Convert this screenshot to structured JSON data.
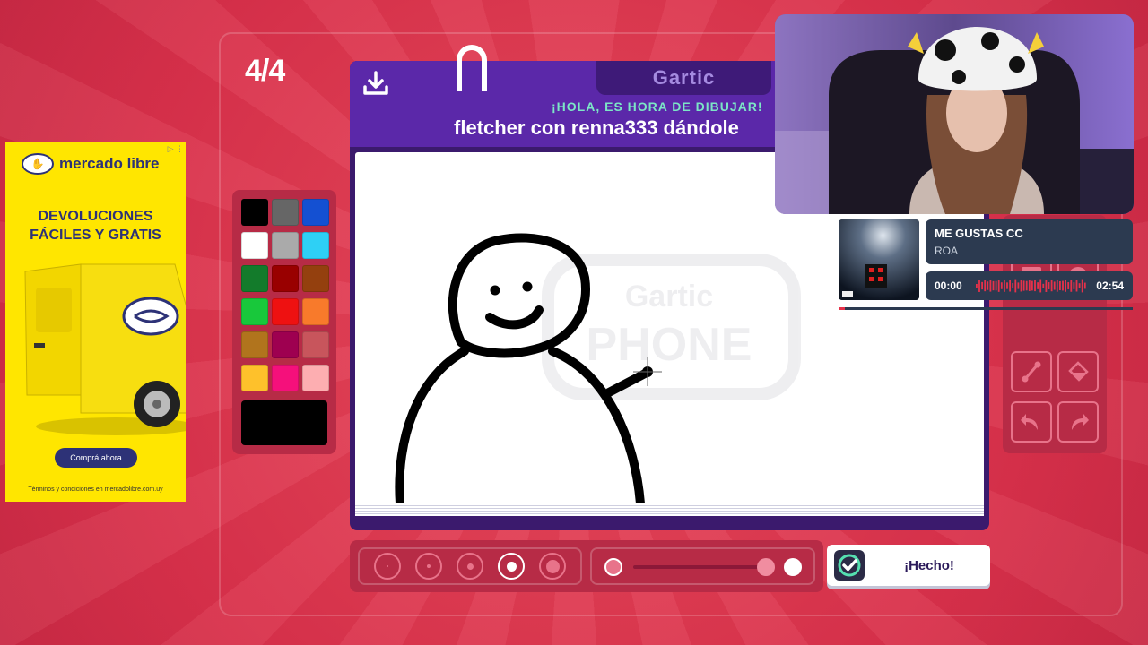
{
  "game": {
    "round": "4/4",
    "logo": "Gartic",
    "subtitle": "¡HOLA, ES HORA DE DIBUJAR!",
    "prompt": "fletcher con renna333 dándole",
    "done_label": "¡Hecho!",
    "watermark_top": "Gartic",
    "watermark_bottom": "PHONE",
    "palette": [
      "#000000",
      "#666666",
      "#1450d2",
      "#ffffff",
      "#aaaaaa",
      "#2ed0f5",
      "#137b2b",
      "#990000",
      "#94400e",
      "#18c83b",
      "#ee1111",
      "#f87a2b",
      "#b1741d",
      "#9e0050",
      "#c8555c",
      "#fec12b",
      "#f5107b",
      "#fdaeb1"
    ],
    "current_color": "#000000",
    "brush_sizes": [
      2,
      4,
      7,
      11,
      15
    ],
    "active_brush_index": 3
  },
  "ad": {
    "brand": "mercado libre",
    "headline_line1": "DEVOLUCIONES",
    "headline_line2": "FÁCILES Y GRATIS",
    "cta": "Comprá ahora",
    "terms": "Términos y condiciones en mercadolibre.com.uy",
    "corner": "▷ ⋮"
  },
  "music": {
    "title": "ME GUSTAS CC",
    "artist": "ROA",
    "elapsed": "00:00",
    "duration": "02:54",
    "progress_fraction": 0.0
  },
  "colors": {
    "background": "#e0384f",
    "panel": "#5b28a9",
    "panel_dark": "#3e1a78",
    "subtitle": "#7ce6c6",
    "tool_panel": "#b72b46"
  },
  "icons": {
    "download": "download-icon",
    "check": "check-icon",
    "handshake": "handshake-icon"
  }
}
